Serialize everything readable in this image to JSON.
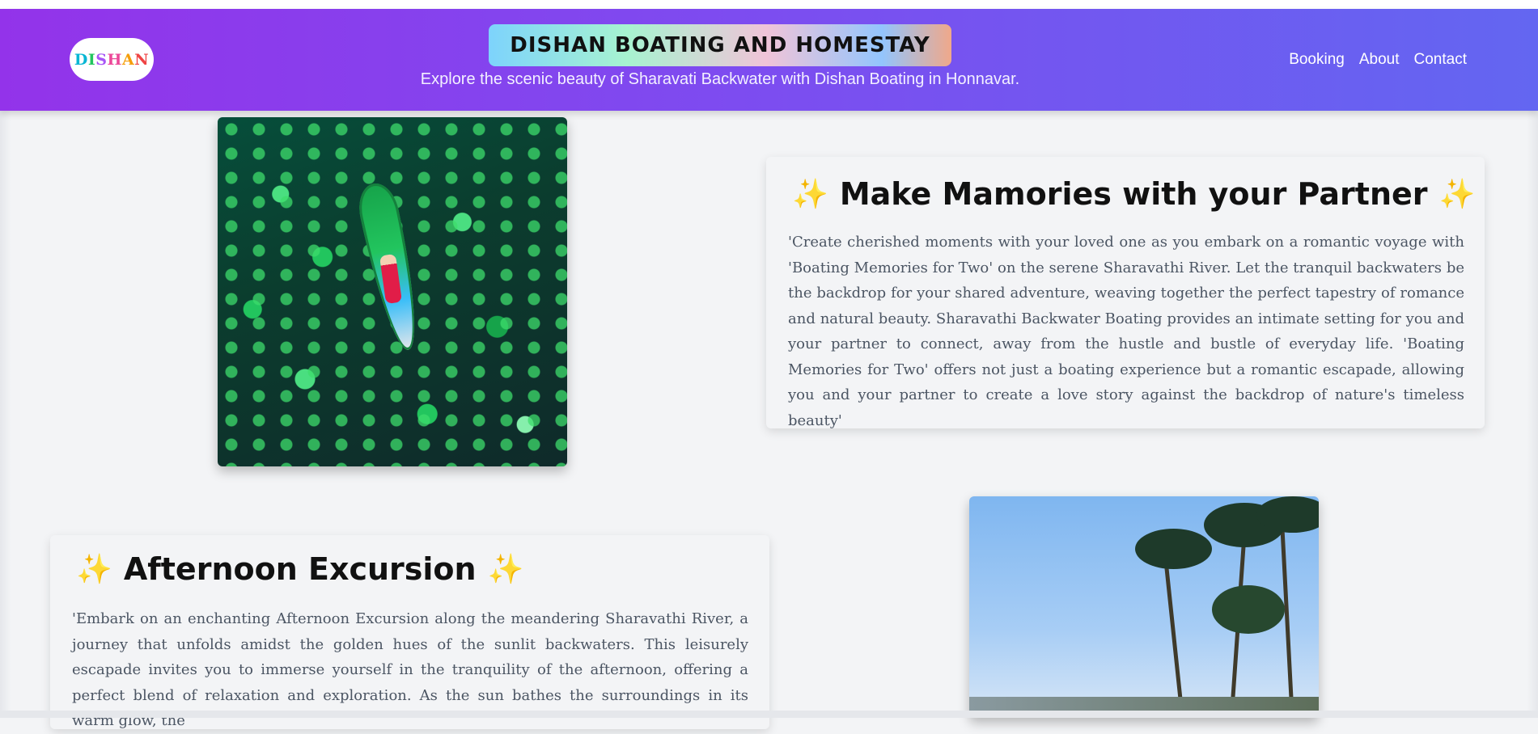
{
  "header": {
    "logo_text": "DISHAN",
    "title": "DISHAN BOATING AND HOMESTAY",
    "tagline": "Explore the scenic beauty of Sharavati Backwater with Dishan Boating in Honnavar.",
    "nav": [
      {
        "label": "Booking"
      },
      {
        "label": "About"
      },
      {
        "label": "Contact"
      }
    ]
  },
  "sections": [
    {
      "heading": "Make Mamories with your Partner",
      "sparkle": "✨",
      "text": "'Create cherished moments with your loved one as you embark on a romantic voyage with 'Boating Memories for Two' on the serene Sharavathi River. Let the tranquil backwaters be the backdrop for your shared adventure, weaving together the perfect tapestry of romance and natural beauty. Sharavathi Backwater Boating provides an intimate setting for you and your partner to connect, away from the hustle and bustle of everyday life. 'Boating Memories for Two' offers not just a boating experience but a romantic escapade, allowing you and your partner to create a love story against the backdrop of nature's timeless beauty'"
    },
    {
      "heading": "Afternoon Excursion",
      "sparkle": "✨",
      "text": "'Embark on an enchanting Afternoon Excursion along the meandering Sharavathi River, a journey that unfolds amidst the golden hues of the sunlit backwaters. This leisurely escapade invites you to immerse yourself in the tranquility of the afternoon, offering a perfect blend of relaxation and exploration. As the sun bathes the surroundings in its warm glow, the"
    }
  ],
  "colors": {
    "header_gradient_start": "#9333ea",
    "header_gradient_end": "#6366f1",
    "sparkle": "#fbbf24",
    "page_bg": "#f3f4f6"
  }
}
